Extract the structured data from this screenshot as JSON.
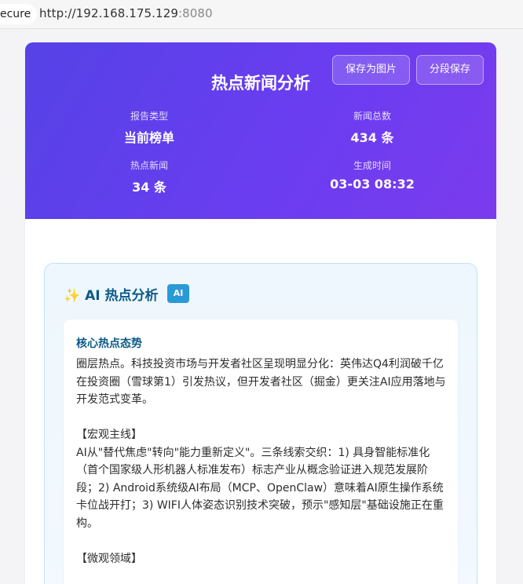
{
  "browser": {
    "secure_label": "ecure",
    "url_main": "http://192.168.175.129",
    "url_port": ":8080"
  },
  "header": {
    "title": "热点新闻分析",
    "save_image_label": "保存为图片",
    "segment_save_label": "分段保存"
  },
  "stats": {
    "report_type_label": "报告类型",
    "report_type_value": "当前榜单",
    "total_news_label": "新闻总数",
    "total_news_value": "434 条",
    "hot_news_label": "热点新闻",
    "hot_news_value": "34 条",
    "generated_label": "生成时间",
    "generated_value": "03-03 08:32"
  },
  "ai_panel": {
    "sparkle": "✨",
    "title": "AI 热点分析",
    "badge": "AI",
    "section_title": "核心热点态势",
    "intro": "圈层热点。科技投资市场与开发者社区呈现明显分化：英伟达Q4利润破千亿在投资圈（雪球第1）引发热议，但开发者社区（掘金）更关注AI应用落地与开发范式变革。",
    "macro_heading": "【宏观主线】",
    "macro_text": "AI从\"替代焦虑\"转向\"能力重新定义\"。三条线索交织：1) 具身智能标准化（首个国家级人形机器人标准发布）标志产业从概念验证进入规范发展阶段；2) Android系统级AI布局（MCP、OpenClaw）意味着AI原生操作系统卡位战开打；3) WIFI人体姿态识别技术突破，预示\"感知层\"基础设施正在重构。",
    "micro_heading": "【微观领域】"
  },
  "colors": {
    "hero_gradient_start": "#5542e6",
    "hero_gradient_end": "#7b3bee",
    "panel_accent": "#0c5a87",
    "badge": "#2a9ad6"
  }
}
